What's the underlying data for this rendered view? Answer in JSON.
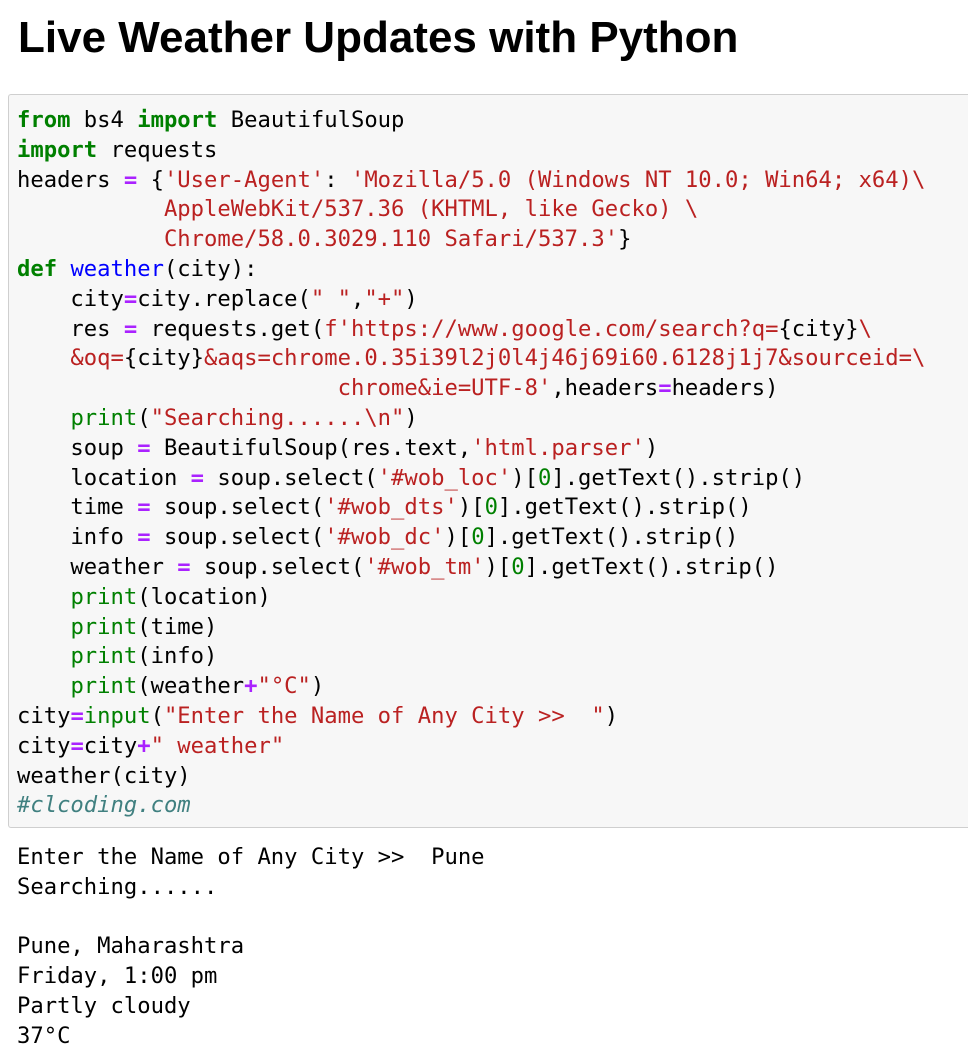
{
  "page": {
    "title": "Live Weather Updates with Python"
  },
  "code_cell": {
    "language": "python",
    "colors": {
      "keyword": "#008000",
      "builtin": "#008000",
      "function_name": "#0000ff",
      "operator": "#aa22ff",
      "string": "#ba2121",
      "number": "#008000",
      "comment": "#408080",
      "cell_background": "#f7f7f7",
      "cell_border": "#cfcfcf"
    },
    "lines": [
      [
        {
          "t": "kw",
          "v": "from"
        },
        {
          "t": "tx",
          "v": " bs4 "
        },
        {
          "t": "kw",
          "v": "import"
        },
        {
          "t": "tx",
          "v": " BeautifulSoup"
        }
      ],
      [
        {
          "t": "kw",
          "v": "import"
        },
        {
          "t": "tx",
          "v": " requests"
        }
      ],
      [
        {
          "t": "tx",
          "v": "headers "
        },
        {
          "t": "op",
          "v": "="
        },
        {
          "t": "tx",
          "v": " {"
        },
        {
          "t": "str",
          "v": "'User-Agent'"
        },
        {
          "t": "tx",
          "v": ": "
        },
        {
          "t": "str",
          "v": "'Mozilla/5.0 (Windows NT 10.0; Win64; x64)\\"
        }
      ],
      [
        {
          "t": "str",
          "v": "           AppleWebKit/537.36 (KHTML, like Gecko) \\"
        }
      ],
      [
        {
          "t": "str",
          "v": "           Chrome/58.0.3029.110 Safari/537.3'"
        },
        {
          "t": "tx",
          "v": "}"
        }
      ],
      [
        {
          "t": "kw",
          "v": "def"
        },
        {
          "t": "tx",
          "v": " "
        },
        {
          "t": "fn",
          "v": "weather"
        },
        {
          "t": "tx",
          "v": "(city):"
        }
      ],
      [
        {
          "t": "tx",
          "v": "    city"
        },
        {
          "t": "op",
          "v": "="
        },
        {
          "t": "tx",
          "v": "city.replace("
        },
        {
          "t": "str",
          "v": "\" \""
        },
        {
          "t": "tx",
          "v": ","
        },
        {
          "t": "str",
          "v": "\"+\""
        },
        {
          "t": "tx",
          "v": ")"
        }
      ],
      [
        {
          "t": "tx",
          "v": "    res "
        },
        {
          "t": "op",
          "v": "="
        },
        {
          "t": "tx",
          "v": " requests.get("
        },
        {
          "t": "str",
          "v": "f'https://www.google.com/search?q="
        },
        {
          "t": "tx",
          "v": "{city}"
        },
        {
          "t": "str",
          "v": "\\"
        }
      ],
      [
        {
          "t": "str",
          "v": "    &oq="
        },
        {
          "t": "tx",
          "v": "{city}"
        },
        {
          "t": "str",
          "v": "&aqs=chrome.0.35i39l2j0l4j46j69i60.6128j1j7&sourceid=\\"
        }
      ],
      [
        {
          "t": "str",
          "v": "                        chrome&ie=UTF-8'"
        },
        {
          "t": "tx",
          "v": ",headers"
        },
        {
          "t": "op",
          "v": "="
        },
        {
          "t": "tx",
          "v": "headers)"
        }
      ],
      [
        {
          "t": "tx",
          "v": "    "
        },
        {
          "t": "bi",
          "v": "print"
        },
        {
          "t": "tx",
          "v": "("
        },
        {
          "t": "str",
          "v": "\"Searching......\\n\""
        },
        {
          "t": "tx",
          "v": ")"
        }
      ],
      [
        {
          "t": "tx",
          "v": "    soup "
        },
        {
          "t": "op",
          "v": "="
        },
        {
          "t": "tx",
          "v": " BeautifulSoup(res.text,"
        },
        {
          "t": "str",
          "v": "'html.parser'"
        },
        {
          "t": "tx",
          "v": ")"
        }
      ],
      [
        {
          "t": "tx",
          "v": "    location "
        },
        {
          "t": "op",
          "v": "="
        },
        {
          "t": "tx",
          "v": " soup.select("
        },
        {
          "t": "str",
          "v": "'#wob_loc'"
        },
        {
          "t": "tx",
          "v": ")["
        },
        {
          "t": "num",
          "v": "0"
        },
        {
          "t": "tx",
          "v": "].getText().strip()"
        }
      ],
      [
        {
          "t": "tx",
          "v": "    time "
        },
        {
          "t": "op",
          "v": "="
        },
        {
          "t": "tx",
          "v": " soup.select("
        },
        {
          "t": "str",
          "v": "'#wob_dts'"
        },
        {
          "t": "tx",
          "v": ")["
        },
        {
          "t": "num",
          "v": "0"
        },
        {
          "t": "tx",
          "v": "].getText().strip()"
        }
      ],
      [
        {
          "t": "tx",
          "v": "    info "
        },
        {
          "t": "op",
          "v": "="
        },
        {
          "t": "tx",
          "v": " soup.select("
        },
        {
          "t": "str",
          "v": "'#wob_dc'"
        },
        {
          "t": "tx",
          "v": ")["
        },
        {
          "t": "num",
          "v": "0"
        },
        {
          "t": "tx",
          "v": "].getText().strip()"
        }
      ],
      [
        {
          "t": "tx",
          "v": "    weather "
        },
        {
          "t": "op",
          "v": "="
        },
        {
          "t": "tx",
          "v": " soup.select("
        },
        {
          "t": "str",
          "v": "'#wob_tm'"
        },
        {
          "t": "tx",
          "v": ")["
        },
        {
          "t": "num",
          "v": "0"
        },
        {
          "t": "tx",
          "v": "].getText().strip()"
        }
      ],
      [
        {
          "t": "tx",
          "v": "    "
        },
        {
          "t": "bi",
          "v": "print"
        },
        {
          "t": "tx",
          "v": "(location)"
        }
      ],
      [
        {
          "t": "tx",
          "v": "    "
        },
        {
          "t": "bi",
          "v": "print"
        },
        {
          "t": "tx",
          "v": "(time)"
        }
      ],
      [
        {
          "t": "tx",
          "v": "    "
        },
        {
          "t": "bi",
          "v": "print"
        },
        {
          "t": "tx",
          "v": "(info)"
        }
      ],
      [
        {
          "t": "tx",
          "v": "    "
        },
        {
          "t": "bi",
          "v": "print"
        },
        {
          "t": "tx",
          "v": "(weather"
        },
        {
          "t": "op",
          "v": "+"
        },
        {
          "t": "str",
          "v": "\"°C\""
        },
        {
          "t": "tx",
          "v": ")"
        }
      ],
      [
        {
          "t": "tx",
          "v": "city"
        },
        {
          "t": "op",
          "v": "="
        },
        {
          "t": "bi",
          "v": "input"
        },
        {
          "t": "tx",
          "v": "("
        },
        {
          "t": "str",
          "v": "\"Enter the Name of Any City >>  \""
        },
        {
          "t": "tx",
          "v": ")"
        }
      ],
      [
        {
          "t": "tx",
          "v": "city"
        },
        {
          "t": "op",
          "v": "="
        },
        {
          "t": "tx",
          "v": "city"
        },
        {
          "t": "op",
          "v": "+"
        },
        {
          "t": "str",
          "v": "\" weather\""
        }
      ],
      [
        {
          "t": "tx",
          "v": "weather(city)"
        }
      ],
      [
        {
          "t": "cm",
          "v": "#clcoding.com"
        }
      ]
    ]
  },
  "output_cell": {
    "lines": [
      "Enter the Name of Any City >>  Pune",
      "Searching......",
      "",
      "Pune, Maharashtra",
      "Friday, 1:00 pm",
      "Partly cloudy",
      "37°C"
    ]
  }
}
